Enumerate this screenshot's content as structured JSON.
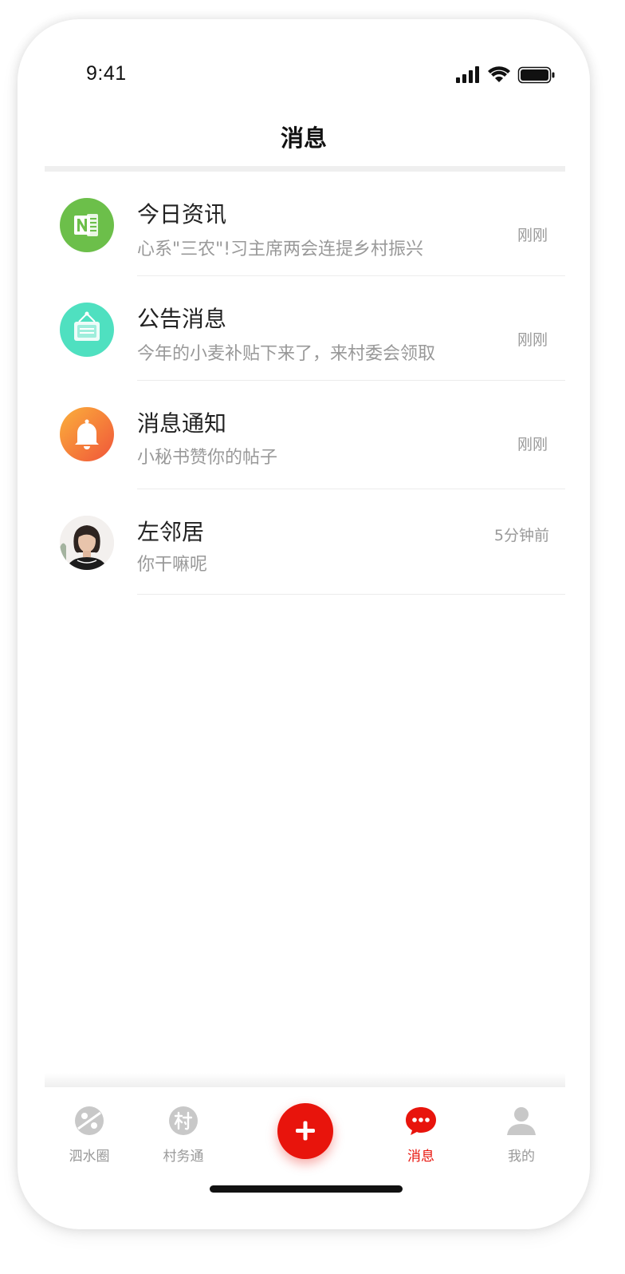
{
  "status_bar": {
    "time": "9:41"
  },
  "header": {
    "title": "消息"
  },
  "messages": [
    {
      "title": "今日资讯",
      "preview": "心系\"三农\"!习主席两会连提乡村振兴",
      "time": "刚刚",
      "icon": "newspaper-icon",
      "color": "#6cbf4a"
    },
    {
      "title": "公告消息",
      "preview": "今年的小麦补贴下来了，来村委会领取",
      "time": "刚刚",
      "icon": "notice-board-icon",
      "color": "#4fe0c0"
    },
    {
      "title": "消息通知",
      "preview": "小秘书赞你的帖子",
      "time": "刚刚",
      "icon": "bell-icon",
      "color": "#f56e3c"
    },
    {
      "title": "左邻居",
      "preview": "你干嘛呢",
      "time": "5分钟前",
      "icon": "user-avatar"
    }
  ],
  "tabbar": {
    "items": [
      {
        "label": "泗水圈",
        "icon": "planet-icon",
        "active": false
      },
      {
        "label": "村务通",
        "icon": "village-icon",
        "active": false
      },
      {
        "label": "",
        "icon": "plus-icon",
        "active": false
      },
      {
        "label": "消息",
        "icon": "chat-bubble-icon",
        "active": true
      },
      {
        "label": "我的",
        "icon": "person-icon",
        "active": false
      }
    ],
    "active_color": "#e8140c",
    "inactive_color": "#999999"
  }
}
